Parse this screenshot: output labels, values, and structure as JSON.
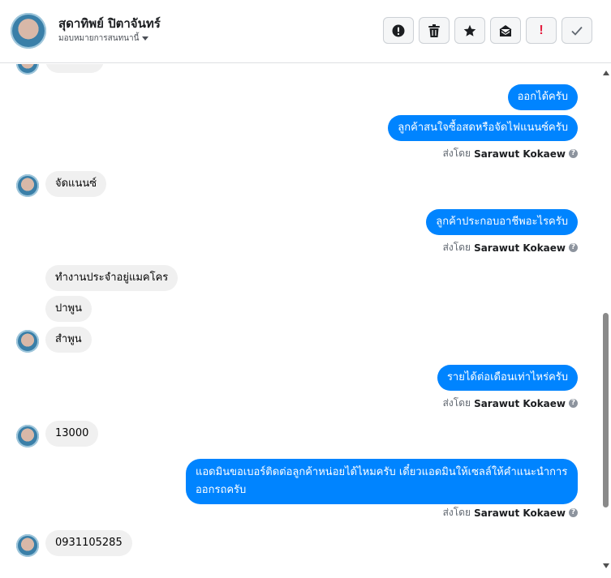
{
  "header": {
    "contact_name": "สุดาทิพย์ ปิตาจันทร์",
    "assign_label": "มอบหมายการสนทนานี้",
    "toolbar": [
      {
        "name": "spam-button",
        "icon": "alert-circle-icon"
      },
      {
        "name": "delete-button",
        "icon": "trash-icon"
      },
      {
        "name": "star-button",
        "icon": "star-icon"
      },
      {
        "name": "mark-unread-button",
        "icon": "envelope-icon"
      },
      {
        "name": "follow-up-button",
        "icon": "exclamation-icon",
        "text": "!"
      },
      {
        "name": "mark-done-button",
        "icon": "checkmark-icon"
      }
    ]
  },
  "sender": {
    "prefix": "ส่งโดย",
    "name": "Sarawut Kokaew"
  },
  "messages": {
    "out1": "ออกได้ครับ",
    "out2": "ลูกค้าสนใจซื้อสดหรือจัดไฟแนนซ์ครับ",
    "in1": "จัดแนนซ์",
    "out3": "ลูกค้าประกอบอาชีพอะไรครับ",
    "in2": "ทำงานประจำอยู่แมคโคร",
    "in3": "ปาพูน",
    "in4": "สำพูน",
    "out4": "รายได้ต่อเดือนเท่าไหร่ครับ",
    "in5": "13000",
    "out5": "แอดมินขอเบอร์ติดต่อลูกค้าหน่อยได้ไหมครับ เดี๋ยวแอดมินให้เซลล์ให้คำแนะนำการออกรถครับ",
    "in6": "0931105285"
  }
}
